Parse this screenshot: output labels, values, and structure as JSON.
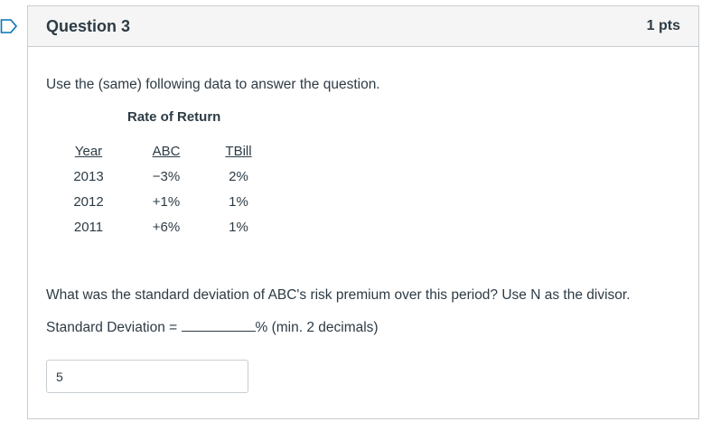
{
  "question": {
    "title": "Question 3",
    "points": "1 pts",
    "intro": "Use the (same) following data to answer the question.",
    "table": {
      "title": "Rate of Return",
      "headers": [
        "Year",
        "ABC",
        "TBill"
      ],
      "rows": [
        [
          "2013",
          "−3%",
          "2%"
        ],
        [
          "2012",
          "+1%",
          "1%"
        ],
        [
          "2011",
          "+6%",
          "1%"
        ]
      ]
    },
    "prompt": "What was the standard deviation of ABC's risk premium over this period? Use N as the divisor.",
    "sd_label": "Standard Deviation = ",
    "sd_suffix": "% (min. 2 decimals)",
    "answer_value": "5"
  },
  "colors": {
    "text": "#2d3b45",
    "border": "#c7cdd1",
    "header_bg": "#f5f5f5",
    "flag": "#0374b5"
  },
  "icons": {
    "flag": "bookmark-flag-icon"
  }
}
